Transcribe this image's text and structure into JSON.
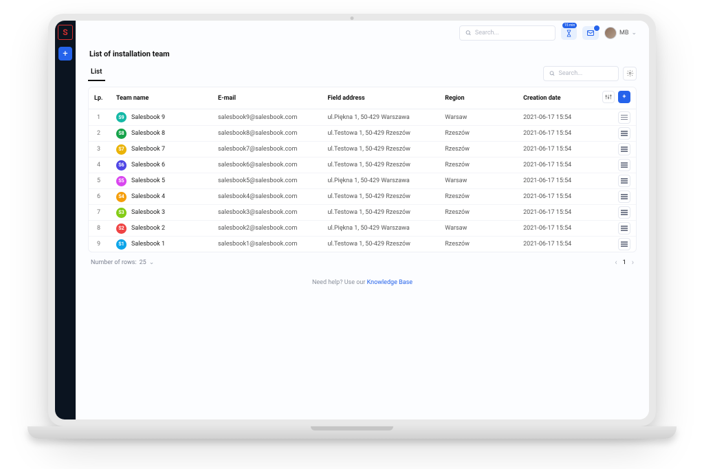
{
  "header": {
    "search_placeholder": "Search...",
    "user_initials": "MB"
  },
  "page": {
    "title": "List of installation team",
    "tab_list": "List",
    "search_placeholder": "Search...",
    "rows_label": "Number of rows:",
    "rows_count": "25",
    "current_page": "1"
  },
  "columns": {
    "lp": "Lp.",
    "team": "Team name",
    "email": "E-mail",
    "address": "Field address",
    "region": "Region",
    "created": "Creation date"
  },
  "rows": [
    {
      "lp": "1",
      "code": "S9",
      "name": "Salesbook 9",
      "email": "salesbook9@salesbook.com",
      "address": "ul.Piękna 1, 50-429 Warszawa",
      "region": "Warsaw",
      "date": "2021-06-17 15:54",
      "color": "#14b8a6"
    },
    {
      "lp": "2",
      "code": "S8",
      "name": "Salesbook 8",
      "email": "salesbook8@salesbook.com",
      "address": "ul.Testowa 1, 50-429 Rzeszów",
      "region": "Rzeszów",
      "date": "2021-06-17 15:54",
      "color": "#16a34a"
    },
    {
      "lp": "3",
      "code": "S7",
      "name": "Salesbook 7",
      "email": "salesbook7@salesbook.com",
      "address": "ul.Testowa 1, 50-429 Rzeszów",
      "region": "Rzeszów",
      "date": "2021-06-17 15:54",
      "color": "#eab308"
    },
    {
      "lp": "4",
      "code": "S6",
      "name": "Salesbook 6",
      "email": "salesbook6@salesbook.com",
      "address": "ul.Testowa 1, 50-429 Rzeszów",
      "region": "Rzeszów",
      "date": "2021-06-17 15:54",
      "color": "#4f46e5"
    },
    {
      "lp": "5",
      "code": "S5",
      "name": "Salesbook 5",
      "email": "salesbook5@salesbook.com",
      "address": "ul.Piękna 1, 50-429 Warszawa",
      "region": "Warsaw",
      "date": "2021-06-17 15:54",
      "color": "#d946ef"
    },
    {
      "lp": "6",
      "code": "S4",
      "name": "Salesbook 4",
      "email": "salesbook4@salesbook.com",
      "address": "ul.Testowa 1, 50-429 Rzeszów",
      "region": "Rzeszów",
      "date": "2021-06-17 15:54",
      "color": "#f59e0b"
    },
    {
      "lp": "7",
      "code": "S3",
      "name": "Salesbook 3",
      "email": "salesbook3@salesbook.com",
      "address": "ul.Testowa 1, 50-429 Rzeszów",
      "region": "Rzeszów",
      "date": "2021-06-17 15:54",
      "color": "#84cc16"
    },
    {
      "lp": "8",
      "code": "S2",
      "name": "Salesbook 2",
      "email": "salesbook2@salesbook.com",
      "address": "ul.Piękna 1, 50-429 Warszawa",
      "region": "Warsaw",
      "date": "2021-06-17 15:54",
      "color": "#ef4444"
    },
    {
      "lp": "9",
      "code": "S1",
      "name": "Salesbook 1",
      "email": "salesbook1@salesbook.com",
      "address": "ul.Testowa 1, 50-429 Rzeszów",
      "region": "Rzeszów",
      "date": "2021-06-17 15:54",
      "color": "#0ea5e9"
    }
  ],
  "help": {
    "prefix": "Need help? Use our ",
    "link": "Knowledge Base"
  }
}
